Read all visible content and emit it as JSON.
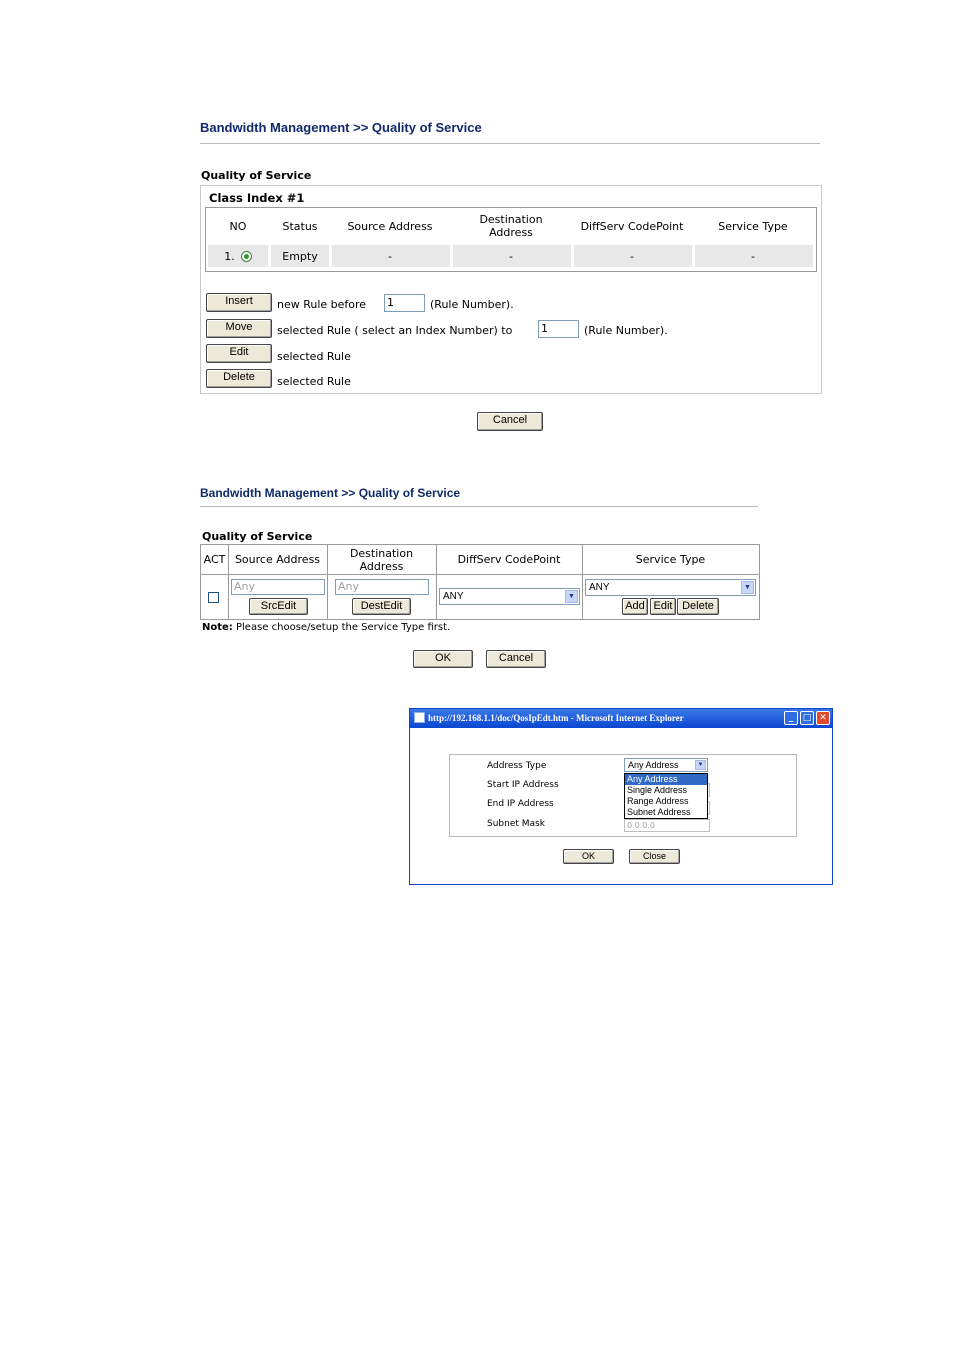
{
  "screen1": {
    "breadcrumb": "Bandwidth Management >> Quality of Service",
    "section_title": "Quality of Service",
    "class_index": "Class Index #1",
    "columns": [
      "NO",
      "Status",
      "Source Address",
      "Destination Address",
      "DiffServ CodePoint",
      "Service Type"
    ],
    "row": {
      "no": "1.",
      "status": "Empty",
      "source": "-",
      "destination": "-",
      "diffserv": "-",
      "service": "-"
    },
    "insert_label": "Insert",
    "insert_text": "new Rule before",
    "insert_value": "1",
    "insert_suffix": "(Rule Number).",
    "move_label": "Move",
    "move_text": "selected Rule ( select an Index Number) to",
    "move_value": "1",
    "move_suffix": "(Rule Number).",
    "edit_label": "Edit",
    "edit_text": "selected Rule",
    "delete_label": "Delete",
    "delete_text": "selected Rule",
    "cancel_label": "Cancel"
  },
  "screen2": {
    "breadcrumb": "Bandwidth Management >> Quality of Service",
    "section_title": "Quality of Service",
    "columns": [
      "ACT",
      "Source Address",
      "Destination Address",
      "DiffServ CodePoint",
      "Service Type"
    ],
    "source_placeholder": "Any",
    "dest_placeholder": "Any",
    "srcedit_label": "SrcEdit",
    "destedit_label": "DestEdit",
    "diffserv_value": "ANY",
    "service_value": "ANY",
    "add_label": "Add",
    "edit_label": "Edit",
    "delete_label": "Delete",
    "note_prefix": "Note:",
    "note_text": "Please choose/setup the Service Type first.",
    "ok_label": "OK",
    "cancel_label": "Cancel"
  },
  "popup": {
    "title": "http://192.168.1.1/doc/QosIpEdt.htm - Microsoft Internet Explorer",
    "labels": [
      "Address Type",
      "Start IP Address",
      "End IP Address",
      "Subnet Mask"
    ],
    "address_type_value": "Any Address",
    "options": [
      "Any Address",
      "Single Address",
      "Range Address",
      "Subnet Address"
    ],
    "subnet_value": "0.0.0.0",
    "ok_label": "OK",
    "close_label": "Close"
  },
  "colors": {
    "title_blue": "#102a6b",
    "highlight": "#316ac5",
    "titlebar": "#0a46d0",
    "close_red": "#e04a2a"
  }
}
